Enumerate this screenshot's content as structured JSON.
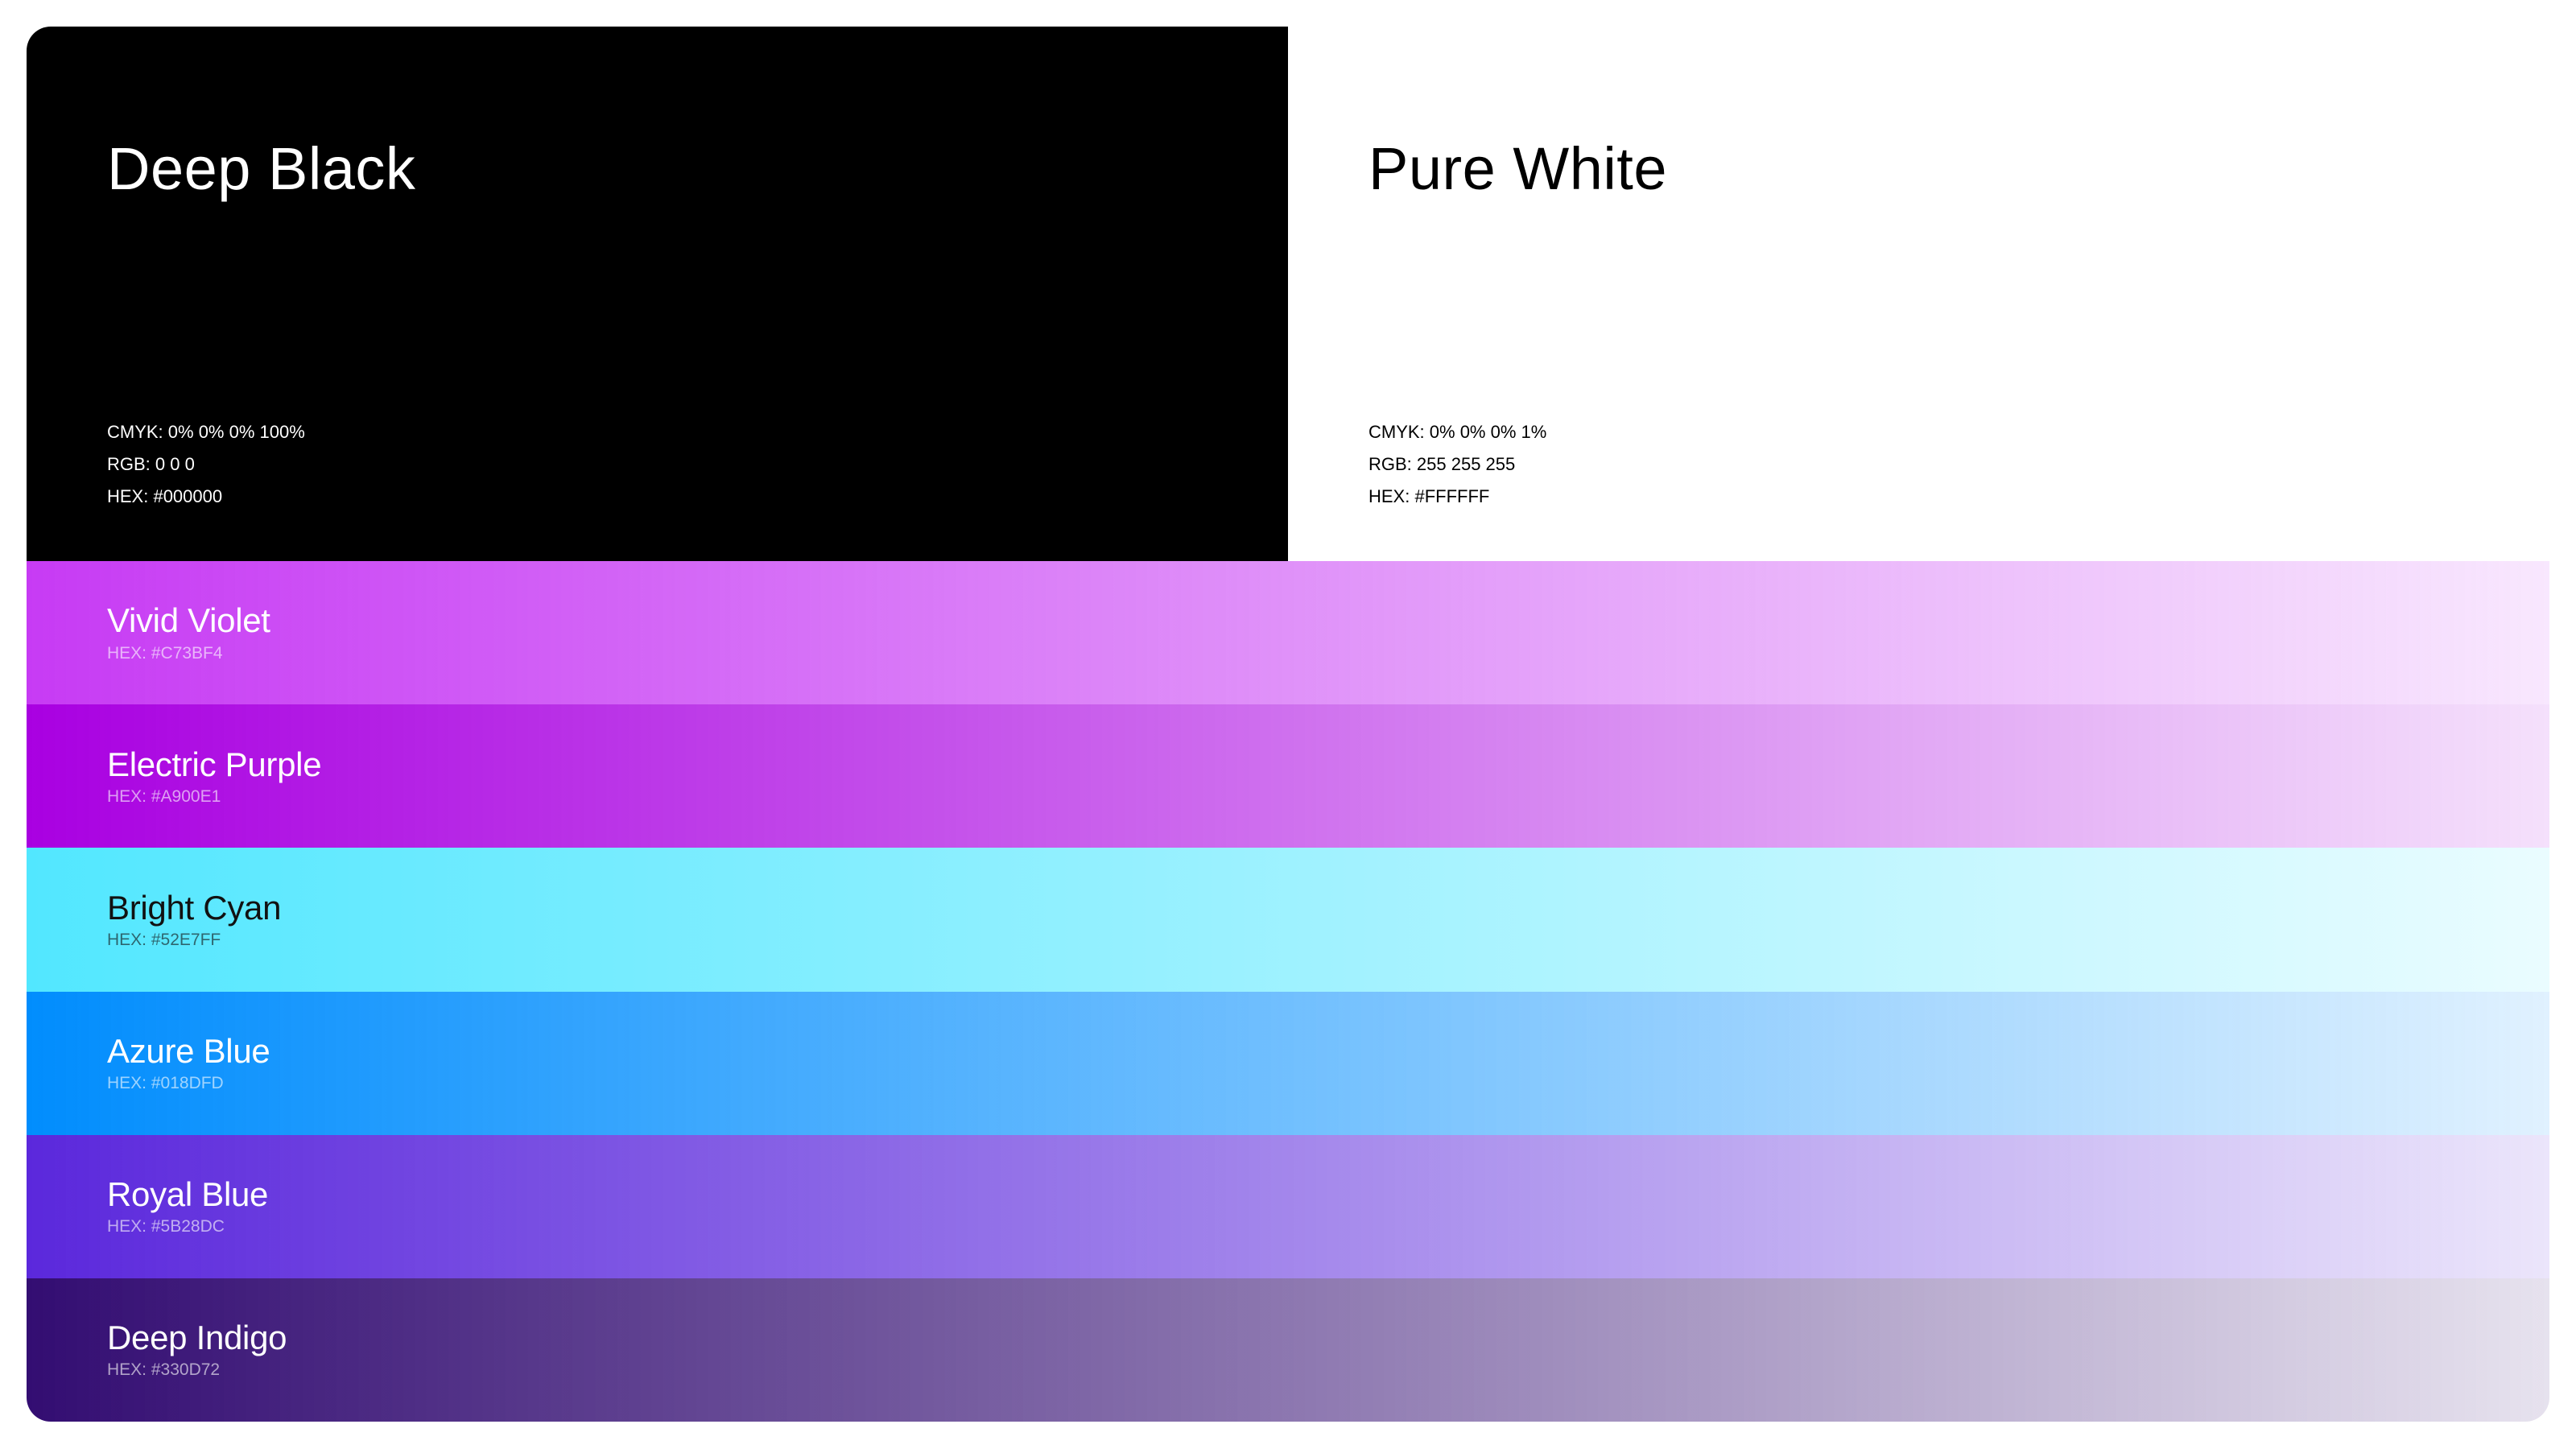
{
  "swatches": [
    {
      "name": "Deep Black",
      "cmyk": "CMYK: 0% 0% 0% 100%",
      "rgb": "RGB: 0 0 0",
      "hex": "HEX: #000000",
      "color": "#000000",
      "text_color": "#ffffff"
    },
    {
      "name": "Pure White",
      "cmyk": "CMYK: 0% 0% 0% 1%",
      "rgb": "RGB: 255 255 255",
      "hex": "HEX: #FFFFFF",
      "color": "#FFFFFF",
      "text_color": "#000000"
    }
  ],
  "gradients": [
    {
      "name": "Vivid Violet",
      "hex": "HEX: #C73BF4",
      "color": "#C73BF4",
      "text_color": "#ffffff"
    },
    {
      "name": "Electric Purple",
      "hex": "HEX: #A900E1",
      "color": "#A900E1",
      "text_color": "#ffffff"
    },
    {
      "name": "Bright Cyan",
      "hex": "HEX: #52E7FF",
      "color": "#52E7FF",
      "text_color": "#111111"
    },
    {
      "name": "Azure Blue",
      "hex": "HEX: #018DFD",
      "color": "#018DFD",
      "text_color": "#ffffff"
    },
    {
      "name": "Royal Blue",
      "hex": "HEX: #5B28DC",
      "color": "#5B28DC",
      "text_color": "#ffffff"
    },
    {
      "name": "Deep Indigo",
      "hex": "HEX: #330D72",
      "color": "#330D72",
      "text_color": "#ffffff"
    }
  ]
}
